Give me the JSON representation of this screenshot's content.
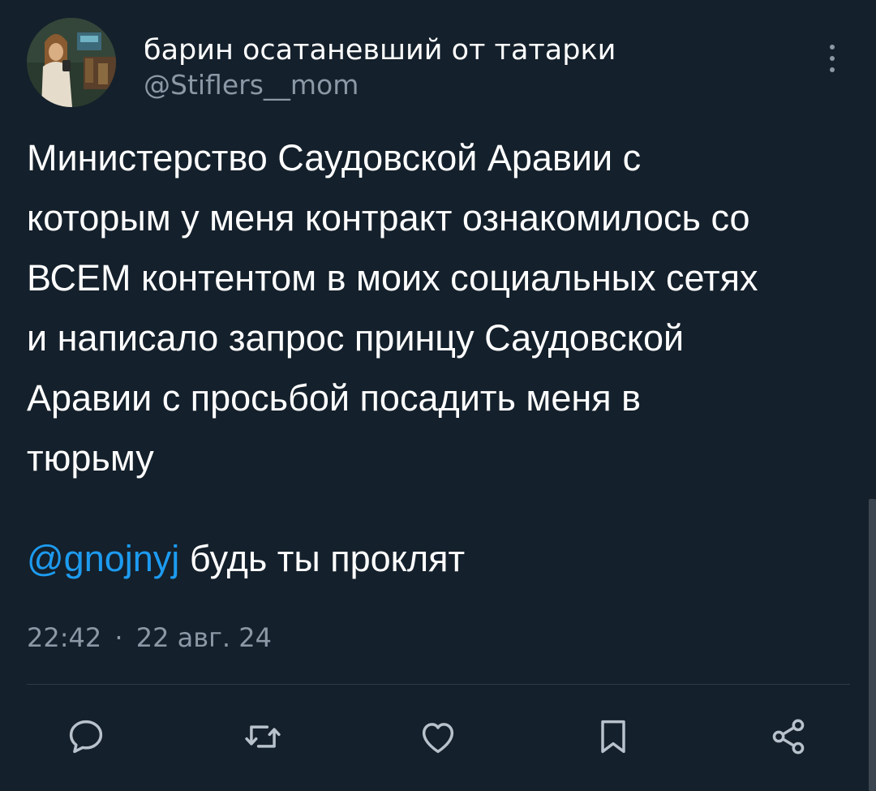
{
  "author": {
    "display_name": "барин осатаневший от татарки",
    "handle": "@Stiflers__mom",
    "avatar_icon": "avatar-photo"
  },
  "tweet": {
    "text": "Министерство Саудовской Аравии с\nкоторым у меня контракт ознакомилось со\nВСЕМ контентом в моих социальных сетях\nи написало запрос принцу Саудовской\nАравии с просьбой посадить меня в\nтюрьму",
    "mention": "@gnojnyj",
    "mention_text": "будь ты проклят",
    "time": "22:42",
    "separator": "·",
    "date": "22 авг. 24"
  },
  "actions": [
    {
      "name": "reply",
      "icon": "reply-icon"
    },
    {
      "name": "retweet",
      "icon": "retweet-icon"
    },
    {
      "name": "like",
      "icon": "heart-icon"
    },
    {
      "name": "bookmark",
      "icon": "bookmark-icon"
    },
    {
      "name": "share",
      "icon": "share-icon"
    }
  ],
  "colors": {
    "background": "#14202b",
    "text": "#ffffff",
    "secondary_text": "#8b98a5",
    "link": "#1d9bf0",
    "icon": "#b8c2cc",
    "divider": "#2f3b47"
  }
}
